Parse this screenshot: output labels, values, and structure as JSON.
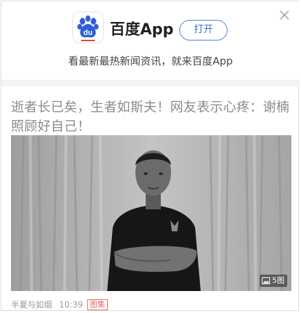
{
  "banner": {
    "app_name": "百度App",
    "open_label": "打开",
    "tagline": "看最新最热新闻资讯，就来百度App",
    "logo_text": "du",
    "close_icon": "close-icon"
  },
  "article": {
    "headline": "逝者长已矣，生者如斯夫！网友表示心疼：谢楠照顾好自己！",
    "image_count": "5图",
    "source": "半夏与如烟",
    "time": "10:39",
    "tag": "图集"
  },
  "colors": {
    "accent": "#3b6fcf",
    "tag": "#e36b6b"
  }
}
